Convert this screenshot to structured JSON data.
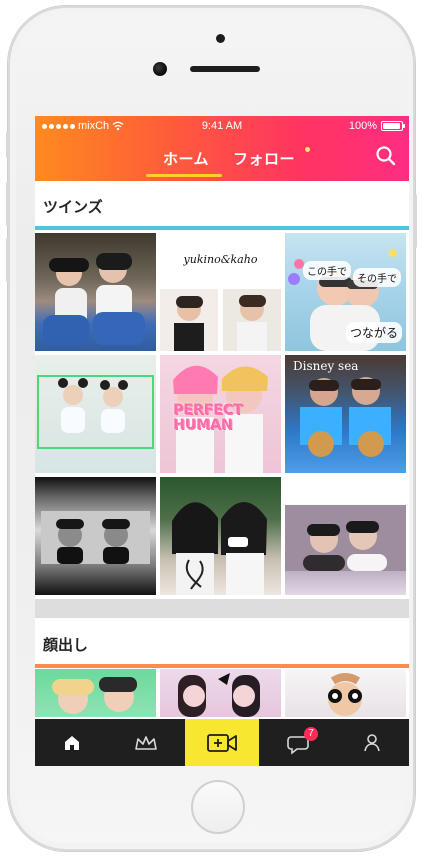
{
  "status_bar": {
    "carrier": "mixCh",
    "time": "9:41 AM",
    "battery": "100%"
  },
  "header": {
    "tabs": [
      {
        "label": "ホーム",
        "active": true
      },
      {
        "label": "フォロー",
        "active": false,
        "has_notification_dot": true
      }
    ],
    "search_icon": "search-icon"
  },
  "sections": [
    {
      "title": "ツインズ",
      "accent_color": "#4fc6dc"
    },
    {
      "title": "顔出し",
      "accent_color": "#ff8b4b"
    }
  ],
  "grid_text": {
    "tile_2_caption": "yukino&kaho",
    "tile_3_left": "この手で",
    "tile_3_right": "その手で",
    "tile_3_bottom": "つながる",
    "tile_5_title": "PERFECT HUMAN",
    "tile_6_title": "Disney sea"
  },
  "bottom_tabs": [
    {
      "name": "home",
      "icon": "home-icon"
    },
    {
      "name": "ranking",
      "icon": "crown-icon"
    },
    {
      "name": "post",
      "icon": "video-add-icon",
      "highlight_color": "#f7e72f"
    },
    {
      "name": "messages",
      "icon": "speech-bubble-icon",
      "badge": "7"
    },
    {
      "name": "profile",
      "icon": "user-icon"
    }
  ],
  "colors": {
    "header_gradient": [
      "#ff8a1f",
      "#ff5d39",
      "#ff3560",
      "#ff2d82"
    ],
    "tab_underline": "#ffcf2e",
    "badge": "#ff2d56",
    "tabbar": "#1f1f1f"
  }
}
